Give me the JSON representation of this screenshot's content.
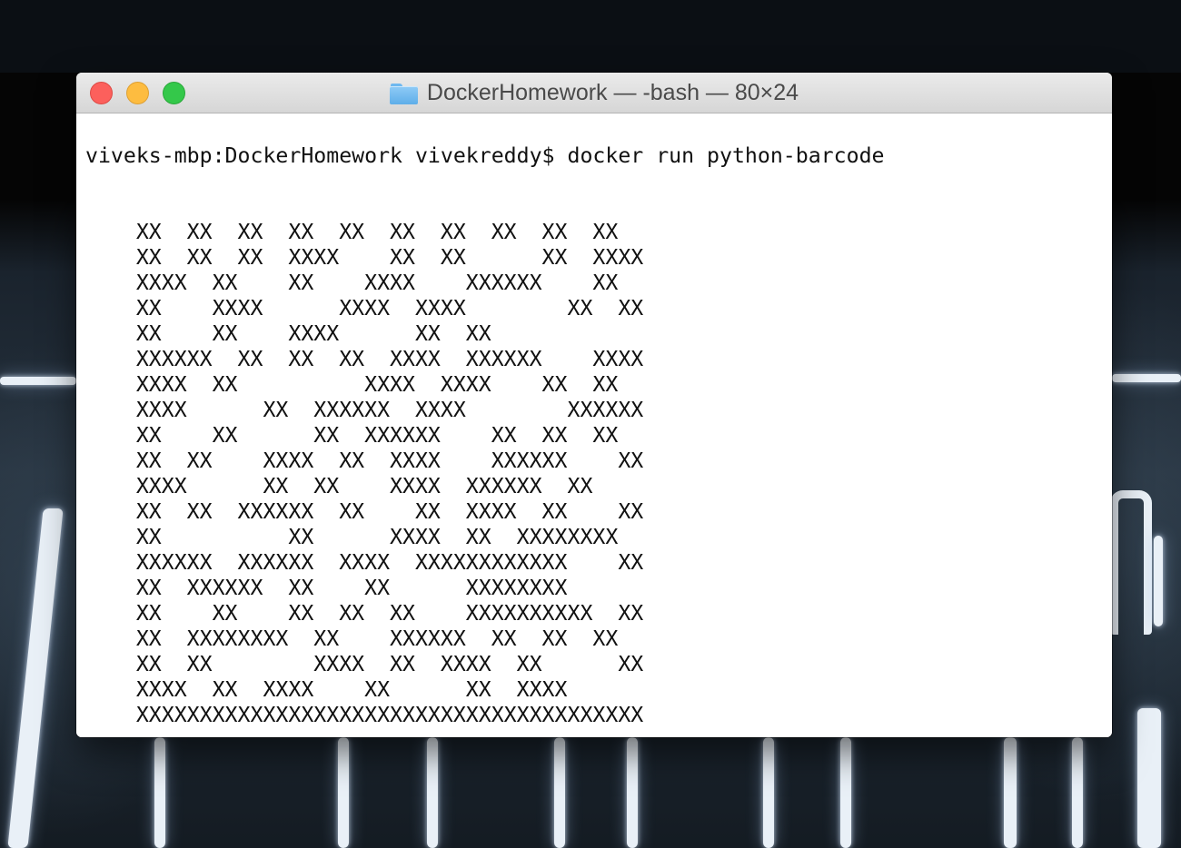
{
  "window": {
    "title": "DockerHomework — -bash — 80×24",
    "folder_icon": "folder-icon",
    "buttons": {
      "close": "close-button",
      "minimize": "minimize-button",
      "zoom": "zoom-button"
    },
    "colors": {
      "close": "#fc605c",
      "minimize": "#fdbc40",
      "zoom": "#34c84a"
    }
  },
  "terminal": {
    "prompt": "viveks-mbp:DockerHomework vivekreddy$ ",
    "command": "docker run python-barcode",
    "output_lines": [
      "    XX  XX  XX  XX  XX  XX  XX  XX  XX  XX",
      "    XX  XX  XX  XXXX    XX  XX      XX  XXXX",
      "    XXXX  XX    XX    XXXX    XXXXXX    XX",
      "    XX    XXXX      XXXX  XXXX        XX  XX",
      "    XX    XX    XXXX      XX  XX",
      "    XXXXXX  XX  XX  XX  XXXX  XXXXXX    XXXX",
      "    XXXX  XX          XXXX  XXXX    XX  XX",
      "    XXXX      XX  XXXXXX  XXXX        XXXXXX",
      "    XX    XX      XX  XXXXXX    XX  XX  XX",
      "    XX  XX    XXXX  XX  XXXX    XXXXXX    XX",
      "    XXXX      XX  XX    XXXX  XXXXXX  XX",
      "    XX  XX  XXXXXX  XX    XX  XXXX  XX    XX",
      "    XX          XX      XXXX  XX  XXXXXXXX",
      "    XXXXXX  XXXXXX  XXXX  XXXXXXXXXXXX    XX",
      "    XX  XXXXXX  XX    XX      XXXXXXXX",
      "    XX    XX    XX  XX  XX    XXXXXXXXXX  XX",
      "    XX  XXXXXXXX  XX    XXXXXX  XX  XX  XX",
      "    XX  XX        XXXX  XX  XXXX  XX      XX",
      "    XXXX  XX  XXXX    XX      XX  XXXX",
      "    XXXXXXXXXXXXXXXXXXXXXXXXXXXXXXXXXXXXXXXX"
    ]
  }
}
